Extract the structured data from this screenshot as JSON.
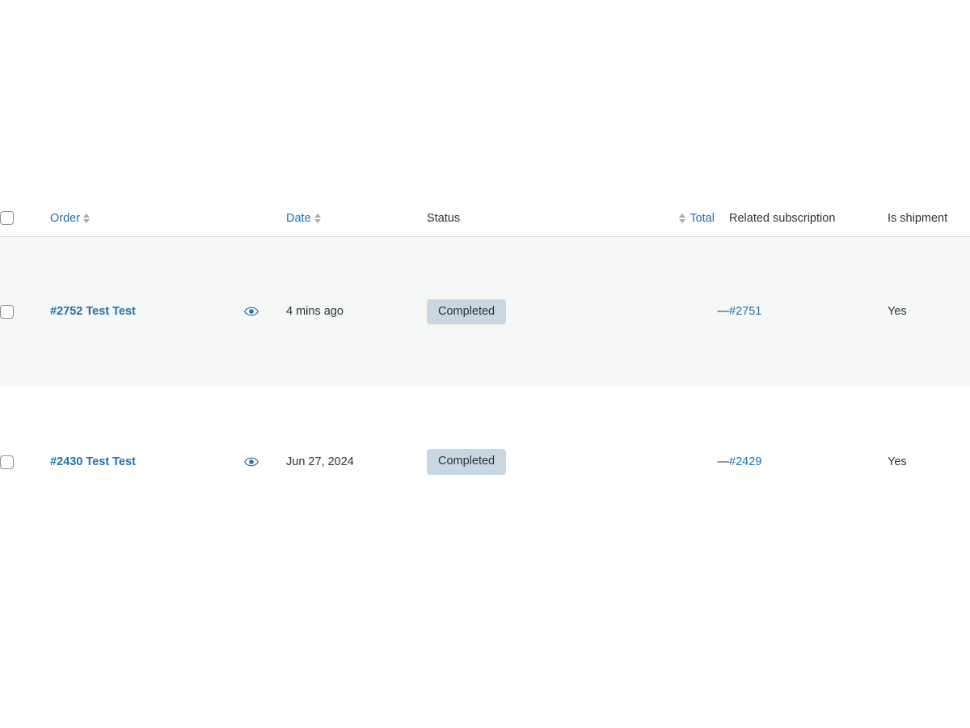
{
  "table": {
    "columns": [
      {
        "key": "checkbox",
        "label": "",
        "type": "checkbox",
        "sortable": false,
        "align": "left"
      },
      {
        "key": "order",
        "label": "Order",
        "type": "link",
        "sortable": true,
        "align": "left"
      },
      {
        "key": "preview",
        "label": "",
        "type": "icon",
        "sortable": false,
        "align": "left"
      },
      {
        "key": "date",
        "label": "Date",
        "type": "link",
        "sortable": true,
        "align": "left"
      },
      {
        "key": "status",
        "label": "Status",
        "type": "text",
        "sortable": false,
        "align": "left"
      },
      {
        "key": "total",
        "label": "Total",
        "type": "link",
        "sortable": true,
        "align": "right"
      },
      {
        "key": "related",
        "label": "Related subscription",
        "type": "text",
        "sortable": false,
        "align": "left"
      },
      {
        "key": "shipment",
        "label": "Is shipment",
        "type": "text",
        "sortable": false,
        "align": "left"
      }
    ],
    "select_all_checkbox": {
      "checked": false,
      "label": "Select all orders"
    },
    "rows": [
      {
        "selected": false,
        "order": "#2752 Test Test",
        "preview_icon": "eye-icon",
        "preview_label": "Preview",
        "date": "4 mins ago",
        "status": "Completed",
        "total": "—",
        "related_subscription": "#2751",
        "is_shipment": "Yes",
        "striped": true
      },
      {
        "selected": false,
        "order": "#2430 Test Test",
        "preview_icon": "eye-icon",
        "preview_label": "Preview",
        "date": "Jun 27, 2024",
        "status": "Completed",
        "total": "—",
        "related_subscription": "#2429",
        "is_shipment": "Yes",
        "striped": false
      }
    ]
  },
  "colors": {
    "link": "#2271b1",
    "text": "#2c3338",
    "muted": "#50575e",
    "row_stripe": "#f6f7f7",
    "border": "#dcdcde",
    "status_badge_bg": "#c8d7e1",
    "sort_arrow": "#a7aaad",
    "checkbox_border": "#8c8f94"
  }
}
